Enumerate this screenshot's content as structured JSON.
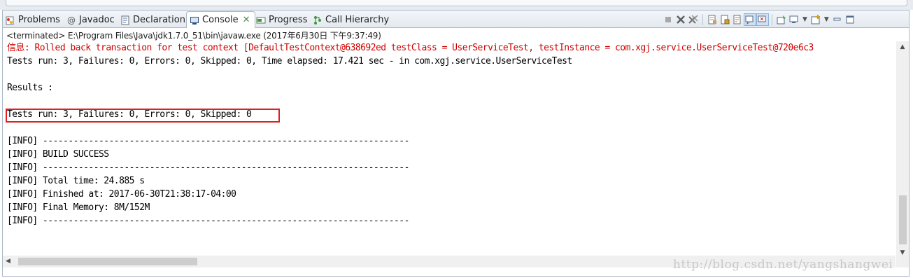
{
  "tabs": [
    {
      "label": "Problems",
      "icon": "problems-icon"
    },
    {
      "label": "Javadoc",
      "icon": "javadoc-at-icon"
    },
    {
      "label": "Declaration",
      "icon": "declaration-icon"
    },
    {
      "label": "Console",
      "icon": "console-icon",
      "active": true,
      "close": "✕"
    },
    {
      "label": "Progress",
      "icon": "progress-icon"
    },
    {
      "label": "Call Hierarchy",
      "icon": "call-hierarchy-icon"
    }
  ],
  "toolbar": [
    "terminate",
    "remove-launch",
    "remove-all-terminated",
    "clear-console",
    "scroll-lock",
    "word-wrap",
    "show-on-stdout",
    "show-on-stderr",
    "pin-console",
    "display-selected-console",
    "open-console",
    "minimize",
    "maximize"
  ],
  "launch_description": "<terminated> E:\\Program Files\\Java\\jdk1.7.0_51\\bin\\javaw.exe (2017年6月30日 下午9:37:49)",
  "console_lines": [
    {
      "text": "信息: Rolled back transaction for test context [DefaultTestContext@638692ed testClass = UserServiceTest, testInstance = com.xgj.service.UserServiceTest@720e6c3",
      "color": "#d00000"
    },
    {
      "text": "Tests run: 3, Failures: 0, Errors: 0, Skipped: 0, Time elapsed: 17.421 sec - in com.xgj.service.UserServiceTest"
    },
    {
      "text": ""
    },
    {
      "text": "Results :"
    },
    {
      "text": ""
    },
    {
      "text": "Tests run: 3, Failures: 0, Errors: 0, Skipped: 0",
      "highlight": true
    },
    {
      "text": ""
    },
    {
      "text": "[INFO] ------------------------------------------------------------------------"
    },
    {
      "text": "[INFO] BUILD SUCCESS"
    },
    {
      "text": "[INFO] ------------------------------------------------------------------------"
    },
    {
      "text": "[INFO] Total time: 24.885 s"
    },
    {
      "text": "[INFO] Finished at: 2017-06-30T21:38:17-04:00"
    },
    {
      "text": "[INFO] Final Memory: 8M/152M"
    },
    {
      "text": "[INFO] ------------------------------------------------------------------------"
    }
  ],
  "watermark": "http://blog.csdn.net/yangshangwei",
  "colors": {
    "error_text": "#d00000",
    "highlight_box": "#e02020",
    "tab_bg": "#e3e9f0"
  }
}
